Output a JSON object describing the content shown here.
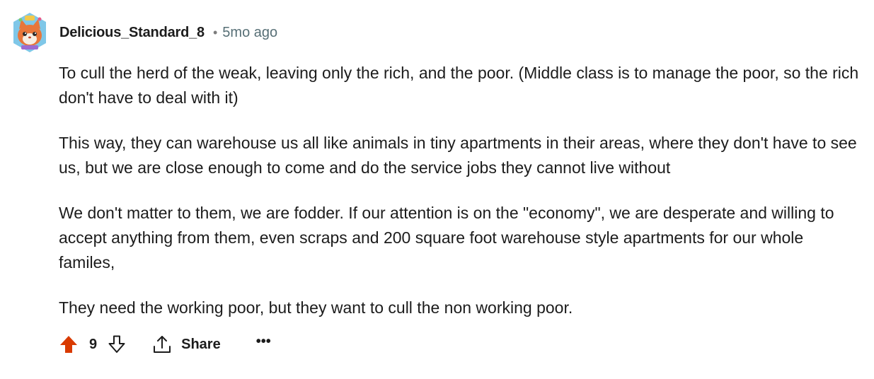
{
  "comment": {
    "author": "Delicious_Standard_8",
    "separator": "•",
    "timestamp": "5mo ago",
    "avatar_icon": "cat-avatar-icon",
    "paragraphs": [
      "To cull the herd of the weak, leaving only the rich, and the poor. (Middle class is to manage the poor, so the rich don't have to deal with it)",
      "This way, they can warehouse us all like animals in tiny apartments in their areas, where they don't have to see us, but we are close enough to come and do the service jobs they cannot live without",
      "We don't matter to them, we are fodder. If our attention is on the \"economy\", we are desperate and willing to accept anything from them, even scraps and 200 square foot warehouse style apartments for our whole familes,",
      "They need the working poor, but they want to cull the non working poor."
    ]
  },
  "actions": {
    "upvote_icon": "upvote-arrow-icon",
    "vote_count": "9",
    "downvote_icon": "downvote-arrow-icon",
    "share_icon": "share-icon",
    "share_label": "Share",
    "more_label": "•••"
  },
  "colors": {
    "upvote_active": "#d93a00",
    "text": "#1c1c1c",
    "muted": "#576f76"
  }
}
